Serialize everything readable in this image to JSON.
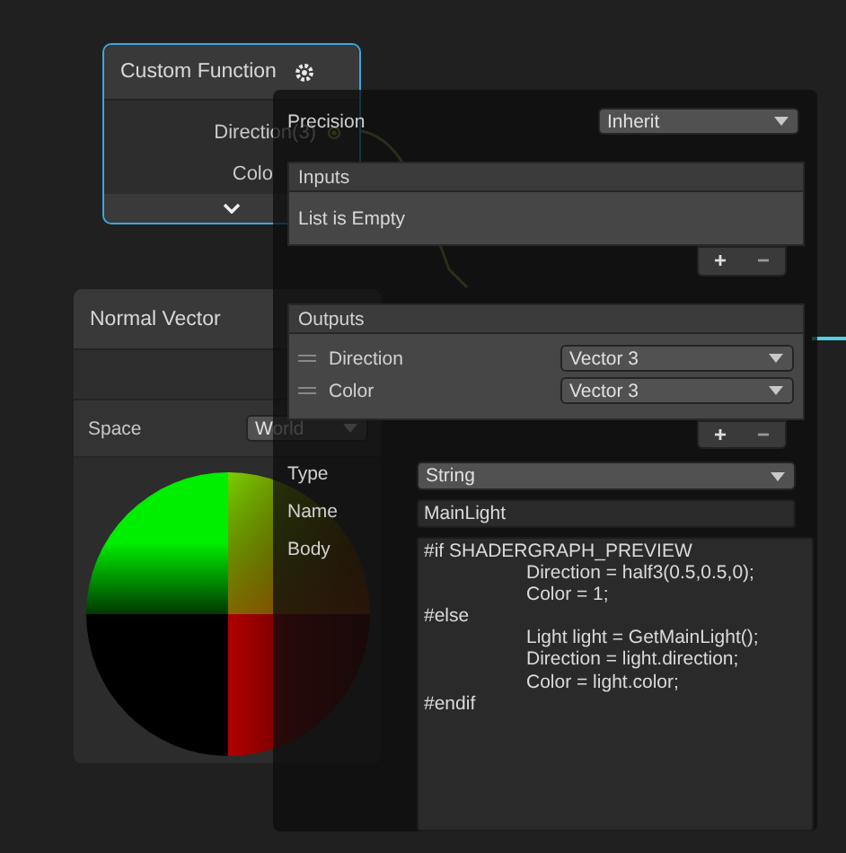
{
  "nodes": [
    {
      "kind": "custom_function",
      "title": "Custom Function",
      "selected": true,
      "outputs": [
        "Direction(3)",
        "Colo"
      ]
    },
    {
      "kind": "normal_vector",
      "title": "Normal Vector",
      "selected": false,
      "space_label": "Space",
      "space_value": "World"
    }
  ],
  "inspector": {
    "precision": {
      "label": "Precision",
      "value": "Inherit"
    },
    "inputs": {
      "title": "Inputs",
      "empty_text": "List is Empty",
      "add": "+",
      "remove": "−"
    },
    "outputs": {
      "title": "Outputs",
      "rows": [
        {
          "name": "Direction",
          "type": "Vector 3"
        },
        {
          "name": "Color",
          "type": "Vector 3"
        }
      ],
      "add": "+",
      "remove": "−"
    },
    "type": {
      "label": "Type",
      "value": "String"
    },
    "name": {
      "label": "Name",
      "value": "MainLight"
    },
    "body": {
      "label": "Body",
      "value": "#if SHADERGRAPH_PREVIEW\n\tDirection = half3(0.5,0.5,0);\n\tColor = 1;\n#else\n\tLight light = GetMainLight();\n\tDirection = light.direction;\n\tColor = light.color;\n#endif"
    }
  }
}
